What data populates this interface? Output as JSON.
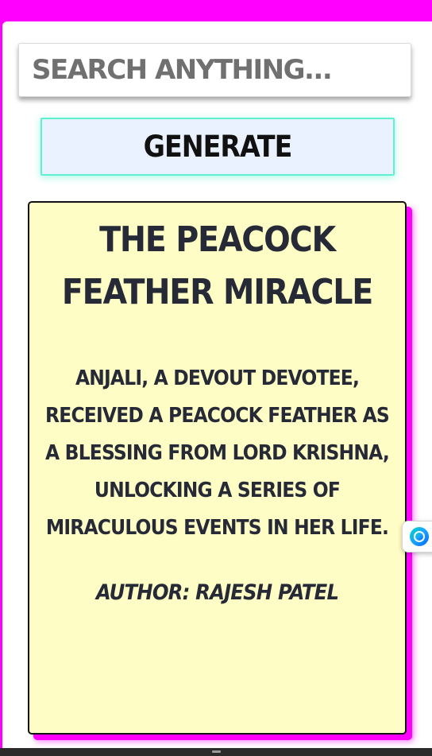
{
  "search": {
    "placeholder": "SEARCH ANYTHING...",
    "value": ""
  },
  "actions": {
    "generate_label": "GENERATE"
  },
  "story": {
    "title": "THE PEACOCK FEATHER MIRACLE",
    "summary": "ANJALI, A DEVOUT DEVOTEE, RECEIVED A PEACOCK FEATHER AS A BLESSING FROM LORD KRISHNA, UNLOCKING A SERIES OF MIRACULOUS EVENTS IN HER LIFE.",
    "author": "AUTHOR: RAJESH PATEL"
  },
  "widget": {
    "icon": "assistant-orb-icon"
  },
  "colors": {
    "page_background": "#ff00ff",
    "card_background": "#fffdc6",
    "card_shadow": "#ff00ff",
    "button_background": "#eaf1ff",
    "button_border": "#5ff0d0",
    "text_dark": "#262a36"
  }
}
